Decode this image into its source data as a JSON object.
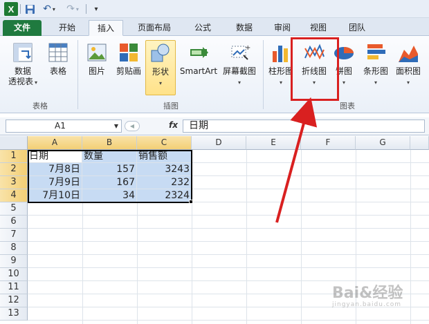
{
  "app": {
    "logo_letter": "X",
    "accent_color": "#1f7a3f",
    "icons": [
      "excel-logo-icon",
      "save-icon",
      "undo-icon",
      "redo-icon",
      "customize-qat-icon"
    ]
  },
  "tabs": [
    {
      "label": "文件"
    },
    {
      "label": "开始"
    },
    {
      "label": "插入"
    },
    {
      "label": "页面布局"
    },
    {
      "label": "公式"
    },
    {
      "label": "数据"
    },
    {
      "label": "审阅"
    },
    {
      "label": "视图"
    },
    {
      "label": "团队"
    }
  ],
  "ribbon": {
    "pivot_line1": "数据",
    "pivot_line2": "透视表",
    "table": "表格",
    "picture": "图片",
    "clipart": "剪贴画",
    "shapes": "形状",
    "smartart": "SmartArt",
    "screenshot": "屏幕截图",
    "column_chart": "柱形图",
    "line_chart": "折线图",
    "pie_chart": "饼图",
    "bar_chart": "条形图",
    "area_chart": "面积图",
    "group_tables": "表格",
    "group_illustrations": "插图",
    "group_charts": "图表",
    "highlight_color": "#d92020"
  },
  "formula_bar": {
    "name_box": "A1",
    "fx": "fx",
    "formula": "日期"
  },
  "grid": {
    "columns": [
      "A",
      "B",
      "C",
      "D",
      "E",
      "F",
      "G"
    ],
    "rows": [
      "1",
      "2",
      "3",
      "4",
      "5",
      "6",
      "7",
      "8",
      "9",
      "10",
      "11",
      "12",
      "13"
    ],
    "cells": {
      "A1": "日期",
      "B1": "数量",
      "C1": "销售额",
      "A2": "7月8日",
      "B2": "157",
      "C2": "3243",
      "A3": "7月9日",
      "B3": "167",
      "C3": "232",
      "A4": "7月10日",
      "B4": "34",
      "C4": "2324"
    },
    "selection_color": "#c7dbf3"
  },
  "watermark": {
    "main": "Bai&经验",
    "sub": "jingyan.baidu.com"
  }
}
